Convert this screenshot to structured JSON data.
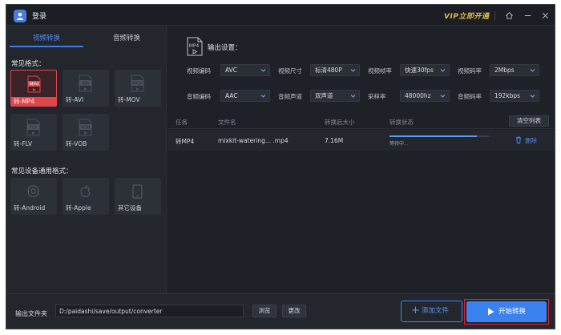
{
  "window": {
    "title": "登录",
    "vip_label": "VIP立即开通"
  },
  "title_icons": [
    "home-icon",
    "minimize-icon",
    "close-icon"
  ],
  "left_panel": {
    "tabs": [
      {
        "label": "视频转换",
        "active": true
      },
      {
        "label": "音频转换",
        "active": false
      }
    ],
    "common_formats_label": "常见格式：",
    "formats": [
      {
        "icon_text": "MP4",
        "label": "转-MP4",
        "selected": true
      },
      {
        "icon_text": "AVI",
        "label": "转-AVI",
        "selected": false
      },
      {
        "icon_text": "MOV",
        "label": "转-MOV",
        "selected": false
      },
      {
        "icon_text": "FLV",
        "label": "转-FLV",
        "selected": false
      },
      {
        "icon_text": "VOB",
        "label": "转-VOB",
        "selected": false
      }
    ],
    "device_formats_label": "常见设备通用格式：",
    "devices": [
      {
        "icon": "android-icon",
        "label": "转-Android"
      },
      {
        "icon": "apple-icon",
        "label": "转-Apple"
      },
      {
        "icon": "tablet-icon",
        "label": "其它设备"
      }
    ]
  },
  "output_settings": {
    "icon_text": "MP4",
    "title": "输出设置：",
    "fields": [
      {
        "label": "视频编码",
        "value": "AVC"
      },
      {
        "label": "视频尺寸",
        "value": "标清480P"
      },
      {
        "label": "视频帧率",
        "value": "快速30fps"
      },
      {
        "label": "视频码率",
        "value": "2Mbps"
      },
      {
        "label": "音频编码",
        "value": "AAC"
      },
      {
        "label": "音频声道",
        "value": "双声道"
      },
      {
        "label": "采样率",
        "value": "48000hz"
      },
      {
        "label": "音频码率",
        "value": "192kbps"
      }
    ]
  },
  "task_list": {
    "headers": {
      "task": "任务",
      "file_name": "文件名",
      "size_after": "转换后大小",
      "status": "转换状态"
    },
    "clear_label": "清空列表",
    "rows": [
      {
        "task": "转MP4",
        "file_name": "mixkit-watering... .mp4",
        "size": "7.16M",
        "status_text": "等待中...",
        "progress": 0.88,
        "delete_label": "删除"
      }
    ]
  },
  "bottom_bar": {
    "output_folder_label": "输出文件夹",
    "path": "D:/paidashi/save/output/converter",
    "browse_label": "浏览",
    "change_label": "更改",
    "add_file_label": "添加文件",
    "start_label": "开始转换"
  },
  "colors": {
    "accent": "#3b82f0",
    "selected_format": "#e0464c",
    "vip": "#e8b84a",
    "highlight_outline": "#e0252a"
  }
}
